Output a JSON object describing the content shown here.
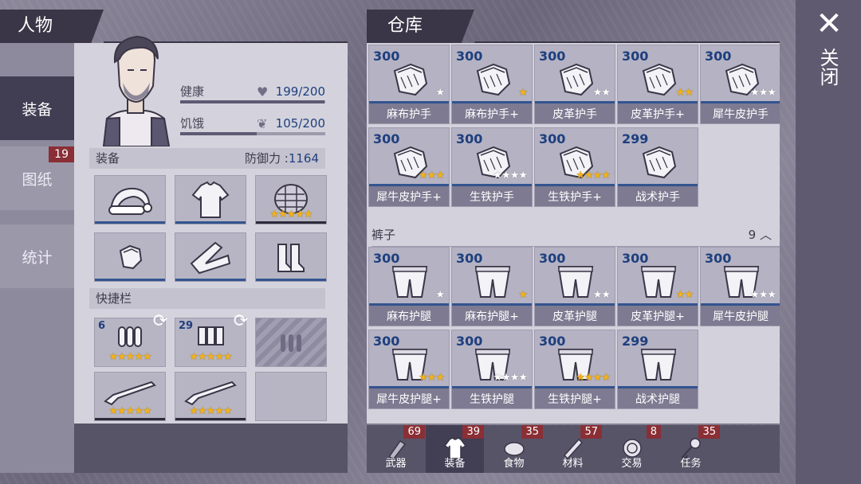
{
  "character": {
    "title": "人物",
    "tabs": [
      {
        "label": "装备"
      },
      {
        "label": "图纸",
        "badge": "19"
      },
      {
        "label": "统计"
      }
    ],
    "stats": [
      {
        "label": "健康",
        "value": "199/200",
        "fill": 0.995
      },
      {
        "label": "饥饿",
        "value": "105/200",
        "fill": 0.525
      }
    ],
    "equipment_label": "装备",
    "defense_label": "防御力 :",
    "defense_value": "1164",
    "quickbar_label": "快捷栏",
    "quickbar": [
      {
        "qty": "6"
      },
      {
        "qty": "29"
      }
    ]
  },
  "warehouse": {
    "title": "仓库",
    "gloves": [
      {
        "price": "300",
        "name": "麻布护手",
        "stars": 1,
        "gold": 0
      },
      {
        "price": "300",
        "name": "麻布护手+",
        "stars": 1,
        "gold": 1
      },
      {
        "price": "300",
        "name": "皮革护手",
        "stars": 2,
        "gold": 0
      },
      {
        "price": "300",
        "name": "皮革护手+",
        "stars": 2,
        "gold": 2
      },
      {
        "price": "300",
        "name": "犀牛皮护手",
        "stars": 3,
        "gold": 0
      },
      {
        "price": "300",
        "name": "犀牛皮护手+",
        "stars": 3,
        "gold": 3
      },
      {
        "price": "300",
        "name": "生铁护手",
        "stars": 4,
        "gold": 0
      },
      {
        "price": "300",
        "name": "生铁护手+",
        "stars": 4,
        "gold": 4
      },
      {
        "price": "299",
        "name": "战术护手",
        "stars": 0,
        "gold": 0
      }
    ],
    "pants_category": "裤子",
    "pants_count": "9",
    "pants": [
      {
        "price": "300",
        "name": "麻布护腿",
        "stars": 1,
        "gold": 0
      },
      {
        "price": "300",
        "name": "麻布护腿+",
        "stars": 1,
        "gold": 1
      },
      {
        "price": "300",
        "name": "皮革护腿",
        "stars": 2,
        "gold": 0
      },
      {
        "price": "300",
        "name": "皮革护腿+",
        "stars": 2,
        "gold": 2
      },
      {
        "price": "300",
        "name": "犀牛皮护腿",
        "stars": 3,
        "gold": 0
      },
      {
        "price": "300",
        "name": "犀牛皮护腿+",
        "stars": 3,
        "gold": 3
      },
      {
        "price": "300",
        "name": "生铁护腿",
        "stars": 4,
        "gold": 0
      },
      {
        "price": "300",
        "name": "生铁护腿+",
        "stars": 4,
        "gold": 4
      },
      {
        "price": "299",
        "name": "战术护腿",
        "stars": 0,
        "gold": 0
      }
    ],
    "bottom_tabs": [
      {
        "label": "武器",
        "count": "69"
      },
      {
        "label": "装备",
        "count": "39"
      },
      {
        "label": "食物",
        "count": "35"
      },
      {
        "label": "材料",
        "count": "57"
      },
      {
        "label": "交易",
        "count": "8"
      },
      {
        "label": "任务",
        "count": "35"
      }
    ]
  },
  "close_label": "关闭",
  "colors": {
    "accent_blue": "#1e3f7e",
    "badge_red": "#8a2f35",
    "star_gold": "#f2b21d"
  }
}
